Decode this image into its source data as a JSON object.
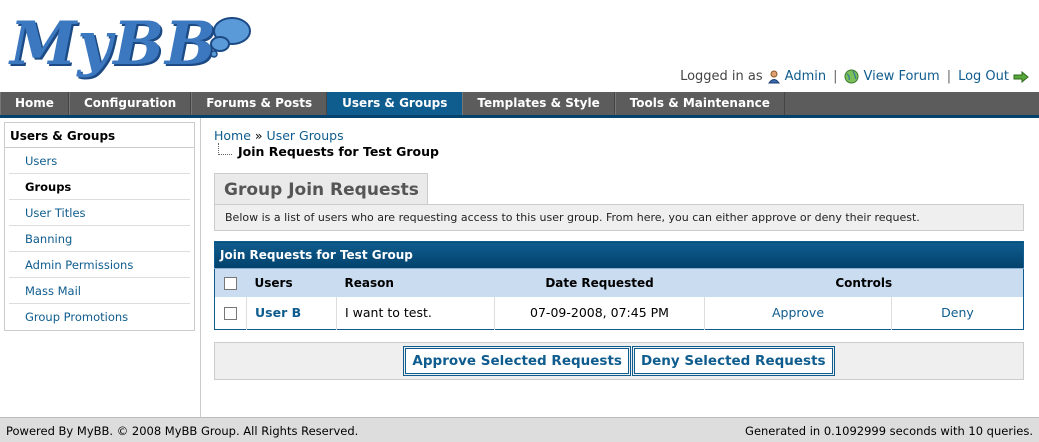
{
  "header": {
    "logo_text": "MyBB",
    "welcome": {
      "logged_in_as": "Logged in as",
      "user": "Admin",
      "view_forum": "View Forum",
      "log_out": "Log Out",
      "separator": "|"
    }
  },
  "menu": {
    "tabs": [
      {
        "label": "Home"
      },
      {
        "label": "Configuration"
      },
      {
        "label": "Forums & Posts"
      },
      {
        "label": "Users & Groups"
      },
      {
        "label": "Templates & Style"
      },
      {
        "label": "Tools & Maintenance"
      }
    ],
    "active_index": 3
  },
  "sidebar": {
    "title": "Users & Groups",
    "items": [
      {
        "label": "Users"
      },
      {
        "label": "Groups"
      },
      {
        "label": "User Titles"
      },
      {
        "label": "Banning"
      },
      {
        "label": "Admin Permissions"
      },
      {
        "label": "Mass Mail"
      },
      {
        "label": "Group Promotions"
      }
    ],
    "active_index": 1
  },
  "breadcrumb": {
    "home": "Home",
    "sep": "»",
    "user_groups": "User Groups",
    "current": "Join Requests for Test Group"
  },
  "page": {
    "heading": "Group Join Requests",
    "description": "Below is a list of users who are requesting access to this user group. From here, you can either approve or deny their request."
  },
  "table": {
    "title": "Join Requests for Test Group",
    "columns": {
      "users": "Users",
      "reason": "Reason",
      "date": "Date Requested",
      "controls": "Controls"
    },
    "rows": [
      {
        "user": "User B",
        "reason": "I want to test.",
        "date": "07-09-2008, 07:45 PM",
        "approve": "Approve",
        "deny": "Deny"
      }
    ]
  },
  "actions": {
    "approve": "Approve Selected Requests",
    "deny": "Deny Selected Requests"
  },
  "footer": {
    "left": "Powered By MyBB. © 2008 MyBB Group. All Rights Reserved.",
    "right": "Generated in 0.1092999 seconds with 10 queries."
  },
  "colors": {
    "accent": "#0f5c8e",
    "menu_bg": "#5c5c5c"
  }
}
